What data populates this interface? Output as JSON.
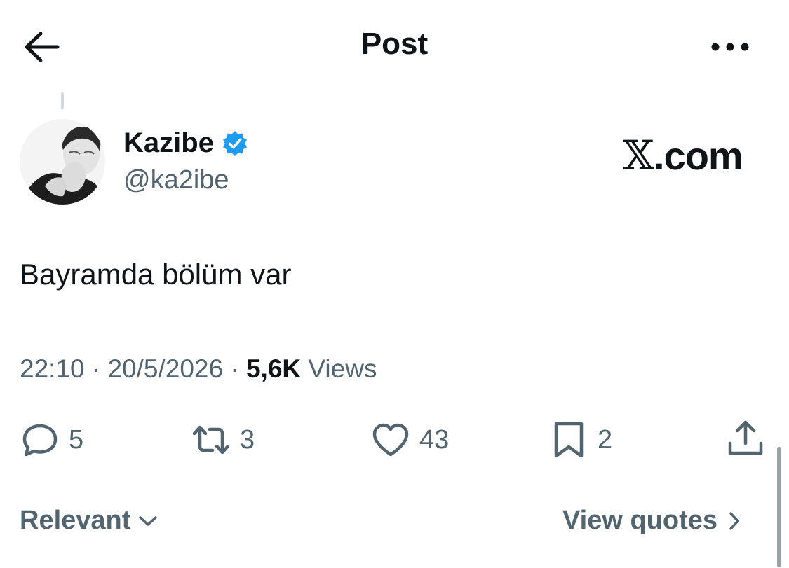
{
  "header": {
    "title": "Post"
  },
  "author": {
    "name": "Kazibe",
    "handle": "@ka2ibe",
    "verified": true
  },
  "brand": {
    "mark": "𝕏",
    "domain": ".com"
  },
  "post": {
    "text": "Bayramda bölüm var"
  },
  "meta": {
    "time": "22:10",
    "separator": "·",
    "date": "20/5/2026",
    "views_count": "5,6K",
    "views_label": "Views"
  },
  "actions": {
    "replies": "5",
    "reposts": "3",
    "likes": "43",
    "bookmarks": "2"
  },
  "footer": {
    "sort_label": "Relevant",
    "quotes_label": "View quotes"
  },
  "colors": {
    "text": "#0f1419",
    "secondary": "#536471",
    "verified": "#1d9bf0",
    "background": "#ffffff"
  },
  "icons": [
    "back-arrow-icon",
    "more-icon",
    "verified-icon",
    "reply-icon",
    "repost-icon",
    "like-icon",
    "bookmark-icon",
    "share-icon",
    "chevron-down-icon",
    "chevron-right-icon"
  ]
}
